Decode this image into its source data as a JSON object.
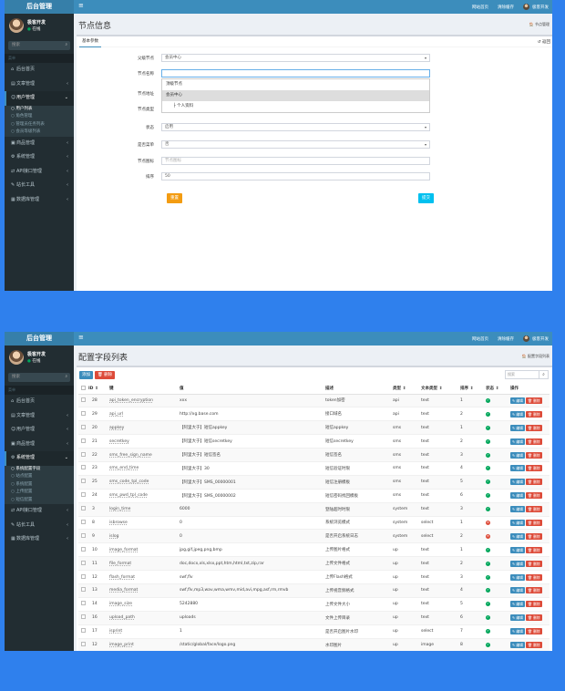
{
  "app": {
    "brand": "后台管理",
    "menu_icon": "hamburger-icon"
  },
  "topbar": {
    "visit_site": "网站首页",
    "clear_cache": "清除缓存",
    "user_name": "极客开发"
  },
  "user": {
    "name": "极客开发",
    "status": "在线"
  },
  "search": {
    "placeholder": "搜索"
  },
  "menu_header": "菜单",
  "screen1": {
    "menu": [
      {
        "label": "后台首页",
        "icon": "home-icon",
        "expandable": false
      },
      {
        "label": "文章管理",
        "icon": "file-icon",
        "expandable": true
      },
      {
        "label": "用户管理",
        "icon": "users-icon",
        "expandable": true,
        "active": true
      }
    ],
    "submenu": [
      "用户列表",
      "角色管理",
      "管理员任务列表",
      "会员等级列表"
    ],
    "menu_after": [
      {
        "label": "商品管理",
        "icon": "shop-icon"
      },
      {
        "label": "系统管理",
        "icon": "gear-icon"
      },
      {
        "label": "API接口管理",
        "icon": "api-icon"
      },
      {
        "label": "站长工具",
        "icon": "tool-icon"
      },
      {
        "label": "数据库管理",
        "icon": "database-icon"
      }
    ],
    "page_title": "节点信息",
    "breadcrumb": "节点管理",
    "tab": "基本参数",
    "refresh": "返回",
    "form": {
      "parent_label": "父级节点",
      "parent_value": "会员中心",
      "name_label": "节点名称",
      "name_value": "",
      "address_label": "节点地址",
      "type_label": "节点类型",
      "status_label": "状态",
      "status_value": "启用",
      "menu_label": "是否菜单",
      "menu_value": "否",
      "icon_label": "节点图标",
      "icon_placeholder": "节点图标",
      "sort_label": "排序",
      "sort_value": "50",
      "reset": "重置",
      "submit": "提交"
    },
    "dropdown": [
      "顶级节点",
      "会员中心",
      "├ 个人资料"
    ]
  },
  "screen2": {
    "menu_before": [
      {
        "label": "后台首页",
        "icon": "home-icon",
        "expandable": false
      },
      {
        "label": "文章管理",
        "icon": "file-icon",
        "expandable": true
      },
      {
        "label": "用户管理",
        "icon": "users-icon",
        "expandable": true
      },
      {
        "label": "商品管理",
        "icon": "shop-icon",
        "expandable": true
      },
      {
        "label": "系统管理",
        "icon": "gear-icon",
        "expandable": true,
        "active": true
      }
    ],
    "submenu": [
      "系统配置字段",
      "站点配置",
      "系统配置",
      "上传配置",
      "短信配置"
    ],
    "menu_after": [
      {
        "label": "API接口管理",
        "icon": "api-icon"
      },
      {
        "label": "站长工具",
        "icon": "tool-icon"
      },
      {
        "label": "数据库管理",
        "icon": "database-icon"
      }
    ],
    "page_title": "配置字段列表",
    "breadcrumb": "配置字段列表",
    "btn_add": "添加",
    "btn_delete": "删除",
    "search_placeholder": "搜索",
    "columns": [
      "ID ⇕",
      "键",
      "值",
      "描述",
      "类型 ⇕",
      "文本类型 ⇕",
      "排序 ⇕",
      "状态 ⇕",
      "操作"
    ],
    "edit": "编辑",
    "del": "删除",
    "rows": [
      {
        "id": "28",
        "key": "api_token_encryption",
        "value": "xxx",
        "desc": "token加密",
        "type": "api",
        "text_type": "text",
        "sort": "1",
        "status": "ok"
      },
      {
        "id": "29",
        "key": "api_url",
        "value": "http://xg.base.com",
        "desc": "接口域名",
        "type": "api",
        "text_type": "text",
        "sort": "2",
        "status": "ok"
      },
      {
        "id": "20",
        "key": "appkey",
        "value": "【阿里大于】短信appkey",
        "desc": "短信appkey",
        "type": "sms",
        "text_type": "text",
        "sort": "1",
        "status": "ok"
      },
      {
        "id": "21",
        "key": "secretkey",
        "value": "【阿里大于】短信secretkey",
        "desc": "短信secretkey",
        "type": "sms",
        "text_type": "text",
        "sort": "2",
        "status": "ok"
      },
      {
        "id": "22",
        "key": "sms_free_sign_name",
        "value": "【阿里大于】短信签名",
        "desc": "短信签名",
        "type": "sms",
        "text_type": "text",
        "sort": "3",
        "status": "ok"
      },
      {
        "id": "23",
        "key": "sms_end_time",
        "value": "【阿里大于】30",
        "desc": "短信验证时限",
        "type": "sms",
        "text_type": "text",
        "sort": "4",
        "status": "ok"
      },
      {
        "id": "25",
        "key": "sms_code_tpl_code",
        "value": "【阿里大于】SMS_00000001",
        "desc": "短信注册模板",
        "type": "sms",
        "text_type": "text",
        "sort": "5",
        "status": "ok"
      },
      {
        "id": "24",
        "key": "sms_pwd_tpl_code",
        "value": "【阿里大于】SMS_00000002",
        "desc": "短信密码找回模板",
        "type": "sms",
        "text_type": "text",
        "sort": "6",
        "status": "ok"
      },
      {
        "id": "3",
        "key": "login_time",
        "value": "6000",
        "desc": "登陆超时时限",
        "type": "system",
        "text_type": "text",
        "sort": "3",
        "status": "ok"
      },
      {
        "id": "8",
        "key": "isbrowse",
        "value": "0",
        "desc": "系统浏览模式",
        "type": "system",
        "text_type": "select",
        "sort": "1",
        "status": "no"
      },
      {
        "id": "9",
        "key": "islog",
        "value": "0",
        "desc": "是否开启系统日志",
        "type": "system",
        "text_type": "select",
        "sort": "2",
        "status": "no"
      },
      {
        "id": "10",
        "key": "image_format",
        "value": "jpg,gif,jpeg,png,bmp",
        "desc": "上传图片格式",
        "type": "up",
        "text_type": "text",
        "sort": "1",
        "status": "ok"
      },
      {
        "id": "11",
        "key": "file_format",
        "value": "doc,docx,xls,xlsx,ppt,htm,html,txt,zip,rar",
        "desc": "上传文件格式",
        "type": "up",
        "text_type": "text",
        "sort": "2",
        "status": "ok"
      },
      {
        "id": "12",
        "key": "flash_format",
        "value": "swf,flv",
        "desc": "上传Flash格式",
        "type": "up",
        "text_type": "text",
        "sort": "3",
        "status": "ok"
      },
      {
        "id": "13",
        "key": "media_format",
        "value": "swf,flv,mp3,wav,wma,wmv,mid,avi,mpg,asf,rm,rmvb",
        "desc": "上传视音频格式",
        "type": "up",
        "text_type": "text",
        "sort": "4",
        "status": "ok"
      },
      {
        "id": "14",
        "key": "image_size",
        "value": "5242880",
        "desc": "上传文件大小",
        "type": "up",
        "text_type": "text",
        "sort": "5",
        "status": "ok"
      },
      {
        "id": "16",
        "key": "upload_path",
        "value": "uploads",
        "desc": "文件上传目录",
        "type": "up",
        "text_type": "text",
        "sort": "6",
        "status": "ok"
      },
      {
        "id": "17",
        "key": "isprint",
        "value": "1",
        "desc": "是否开启图片水印",
        "type": "up",
        "text_type": "select",
        "sort": "7",
        "status": "ok"
      },
      {
        "id": "12",
        "key": "image_print",
        "value": "/static/global/face/logo.png",
        "desc": "水印图片",
        "type": "up",
        "text_type": "image",
        "sort": "8",
        "status": "ok"
      }
    ]
  },
  "colors": {
    "topbar": "#3c8dbc",
    "brand": "#367fa9",
    "sidebar": "#222d32",
    "primary": "#3c8dbc",
    "danger": "#dd4b39",
    "warning": "#f39c12",
    "info": "#00c0ef",
    "success": "#00a65a",
    "background": "#2f80ed"
  }
}
